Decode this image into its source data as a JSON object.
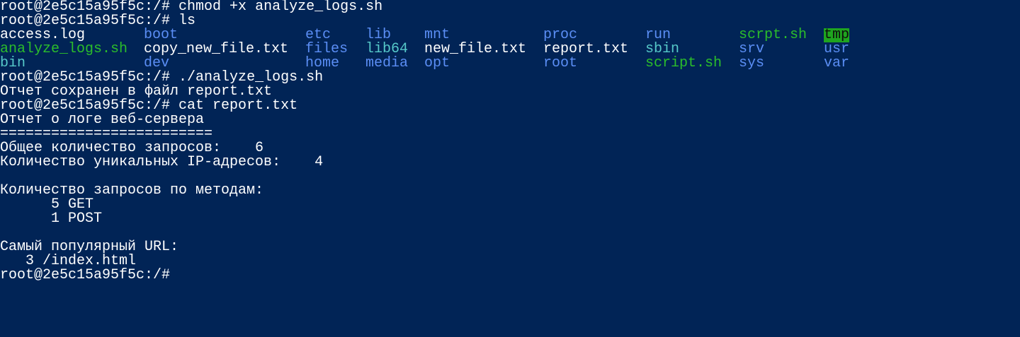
{
  "terminal": {
    "prompt": "root@2e5c15a95f5c:/# ",
    "cmd1": "chmod +x analyze_logs.sh",
    "cmd2": "ls",
    "cmd3": "./analyze_logs.sh",
    "saved_msg": "Отчет сохранен в файл report.txt",
    "cmd4": "cat report.txt",
    "report": {
      "title": "Отчет о логе веб-сервера",
      "separator": "=========================",
      "total": "Общее количество запросов:    6",
      "unique_ips": "Количество уникальных IP-адресов:    4",
      "methods_header": "Количество запросов по методам:",
      "method_get": "      5 GET",
      "method_post": "      1 POST",
      "url_header": "Самый популярный URL:",
      "url_top": "   3 /index.html"
    },
    "ls_rows": [
      [
        "access.log",
        "boot",
        "etc",
        "lib",
        "mnt",
        "proc",
        "run",
        "scrpt.sh",
        "tmp"
      ],
      [
        "analyze_logs.sh",
        "copy_new_file.txt",
        "files",
        "lib64",
        "new_file.txt",
        "report.txt",
        "sbin",
        "srv",
        "usr"
      ],
      [
        "bin",
        "dev",
        "home",
        "media",
        "opt",
        "root",
        "script.sh",
        "sys",
        "var"
      ]
    ]
  },
  "colors": {
    "background": "#012456",
    "text": "#ffffff",
    "directory": "#5b8ef5",
    "executable": "#2bbd2b",
    "symlink": "#56c9c9",
    "sticky_dir_bg": "#1fa51f"
  }
}
